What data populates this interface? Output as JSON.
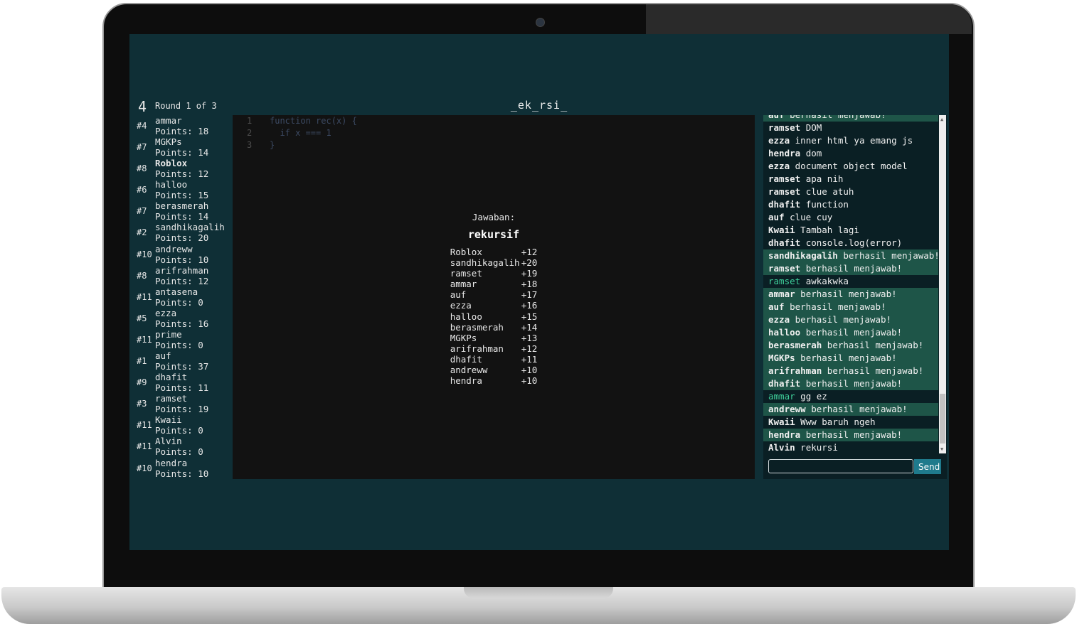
{
  "header": {
    "round_number": "4",
    "round_text": "Round 1 of 3",
    "word_hint": "_ek_rsi_"
  },
  "players": [
    {
      "rank": "#4",
      "name": "ammar",
      "points": "Points: 18"
    },
    {
      "rank": "#7",
      "name": "MGKPs",
      "points": "Points: 14"
    },
    {
      "rank": "#8",
      "name": "Roblox",
      "points": "Points: 12"
    },
    {
      "rank": "#6",
      "name": "halloo",
      "points": "Points: 15"
    },
    {
      "rank": "#7",
      "name": "berasmerah",
      "points": "Points: 14"
    },
    {
      "rank": "#2",
      "name": "sandhikagalih",
      "points": "Points: 20"
    },
    {
      "rank": "#10",
      "name": "andreww",
      "points": "Points: 10"
    },
    {
      "rank": "#8",
      "name": "arifrahman",
      "points": "Points: 12"
    },
    {
      "rank": "#11",
      "name": "antasena",
      "points": "Points: 0"
    },
    {
      "rank": "#5",
      "name": "ezza",
      "points": "Points: 16"
    },
    {
      "rank": "#11",
      "name": "prime",
      "points": "Points: 0"
    },
    {
      "rank": "#1",
      "name": "auf",
      "points": "Points: 37"
    },
    {
      "rank": "#9",
      "name": "dhafit",
      "points": "Points: 11"
    },
    {
      "rank": "#3",
      "name": "ramset",
      "points": "Points: 19"
    },
    {
      "rank": "#11",
      "name": "Kwaii",
      "points": "Points: 0"
    },
    {
      "rank": "#11",
      "name": "Alvin",
      "points": "Points: 0"
    },
    {
      "rank": "#10",
      "name": "hendra",
      "points": "Points: 10"
    }
  ],
  "code": [
    {
      "ln": "1",
      "text": "function rec(x) {"
    },
    {
      "ln": "2",
      "text": "  if x === 1"
    },
    {
      "ln": "3",
      "text": "}"
    }
  ],
  "results": {
    "label": "Jawaban:",
    "word": "rekursif",
    "scores": [
      {
        "name": "Roblox",
        "delta": "+12"
      },
      {
        "name": "sandhikagalih",
        "delta": "+20"
      },
      {
        "name": "ramset",
        "delta": "+19"
      },
      {
        "name": "ammar",
        "delta": "+18"
      },
      {
        "name": "auf",
        "delta": "+17"
      },
      {
        "name": "ezza",
        "delta": "+16"
      },
      {
        "name": "halloo",
        "delta": "+15"
      },
      {
        "name": "berasmerah",
        "delta": "+14"
      },
      {
        "name": "MGKPs",
        "delta": "+13"
      },
      {
        "name": "arifrahman",
        "delta": "+12"
      },
      {
        "name": "dhafit",
        "delta": "+11"
      },
      {
        "name": "andreww",
        "delta": "+10"
      },
      {
        "name": "hendra",
        "delta": "+10"
      }
    ]
  },
  "chat": {
    "messages": [
      {
        "user": "auf",
        "text": "berhasil menjawab!",
        "style": "correct partial"
      },
      {
        "user": "ramset",
        "text": "DOM",
        "style": ""
      },
      {
        "user": "ezza",
        "text": "inner html ya emang js",
        "style": ""
      },
      {
        "user": "hendra",
        "text": "dom",
        "style": ""
      },
      {
        "user": "ezza",
        "text": "document object model",
        "style": ""
      },
      {
        "user": "ramset",
        "text": "apa nih",
        "style": ""
      },
      {
        "user": "ramset",
        "text": "clue atuh",
        "style": ""
      },
      {
        "user": "dhafit",
        "text": "function",
        "style": ""
      },
      {
        "user": "auf",
        "text": "clue cuy",
        "style": ""
      },
      {
        "user": "Kwaii",
        "text": "Tambah lagi",
        "style": ""
      },
      {
        "user": "dhafit",
        "text": "console.log(error)",
        "style": ""
      },
      {
        "user": "sandhikagalih",
        "text": "berhasil menjawab!",
        "style": "correct"
      },
      {
        "user": "ramset",
        "text": "berhasil menjawab!",
        "style": "correct"
      },
      {
        "user": "ramset",
        "text": "awkakwka",
        "style": "guessed"
      },
      {
        "user": "ammar",
        "text": "berhasil menjawab!",
        "style": "correct"
      },
      {
        "user": "auf",
        "text": "berhasil menjawab!",
        "style": "correct"
      },
      {
        "user": "ezza",
        "text": "berhasil menjawab!",
        "style": "correct"
      },
      {
        "user": "halloo",
        "text": "berhasil menjawab!",
        "style": "correct"
      },
      {
        "user": "berasmerah",
        "text": "berhasil menjawab!",
        "style": "correct"
      },
      {
        "user": "MGKPs",
        "text": "berhasil menjawab!",
        "style": "correct"
      },
      {
        "user": "arifrahman",
        "text": "berhasil menjawab!",
        "style": "correct"
      },
      {
        "user": "dhafit",
        "text": "berhasil menjawab!",
        "style": "correct"
      },
      {
        "user": "ammar",
        "text": "gg ez",
        "style": "guessed"
      },
      {
        "user": "andreww",
        "text": "berhasil menjawab!",
        "style": "correct"
      },
      {
        "user": "Kwaii",
        "text": "Www baruh ngeh",
        "style": ""
      },
      {
        "user": "hendra",
        "text": "berhasil menjawab!",
        "style": "correct"
      },
      {
        "user": "Alvin",
        "text": "rekursi",
        "style": ""
      }
    ],
    "input_value": "",
    "send_label": "Send"
  },
  "colors": {
    "screen_bg": "#0f2f36",
    "canvas_bg": "#121212",
    "correct_bg": "#1e5548",
    "guessed_name": "#3ecf9a",
    "send_button": "#1f7a8c"
  }
}
